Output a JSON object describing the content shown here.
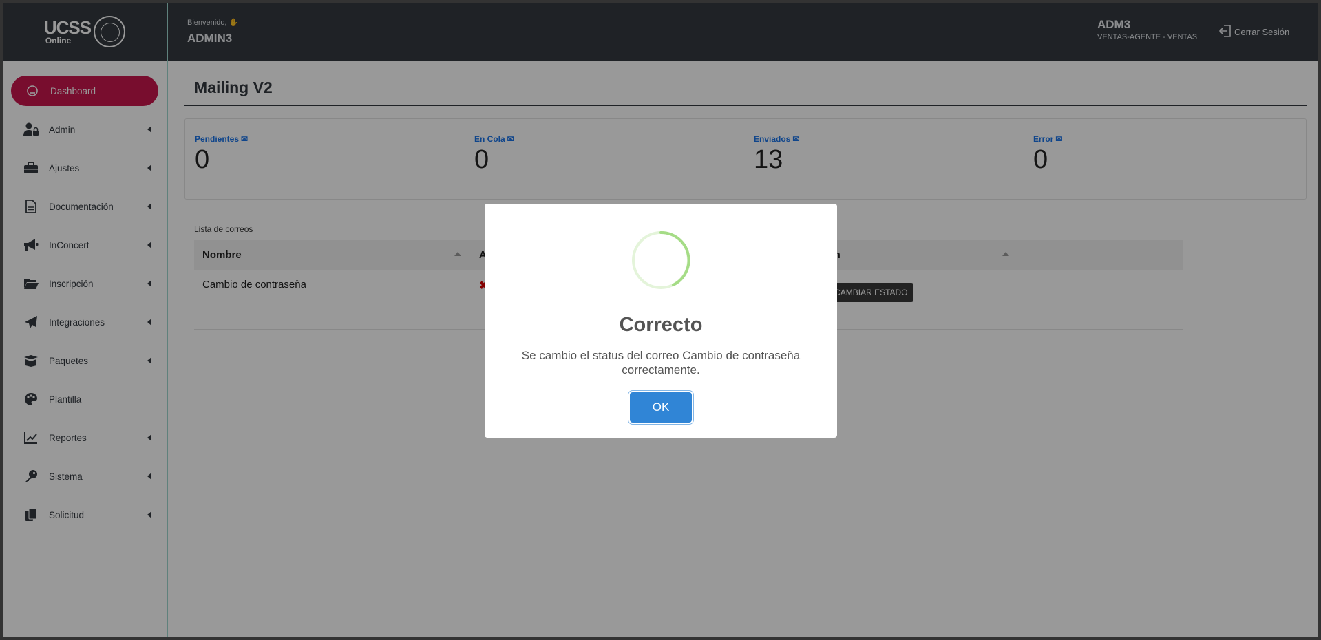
{
  "brand": {
    "name": "UCSS",
    "sub": "Online"
  },
  "header": {
    "welcome": "Bienvenido,",
    "user_name": "ADMIN3",
    "user_code": "ADM3",
    "user_role": "VENTAS-AGENTE - VENTAS",
    "logout_label": "Cerrar Sesión"
  },
  "sidebar": {
    "items": [
      {
        "label": "Dashboard",
        "icon": "dashboard-icon",
        "active": true
      },
      {
        "label": "Admin",
        "icon": "user-lock-icon"
      },
      {
        "label": "Ajustes",
        "icon": "toolbox-icon"
      },
      {
        "label": "Documentación",
        "icon": "file-icon"
      },
      {
        "label": "InConcert",
        "icon": "megaphone-icon"
      },
      {
        "label": "Inscripción",
        "icon": "folder-open-icon"
      },
      {
        "label": "Integraciones",
        "icon": "paper-plane-icon"
      },
      {
        "label": "Paquetes",
        "icon": "box-open-icon"
      },
      {
        "label": "Plantilla",
        "icon": "palette-icon"
      },
      {
        "label": "Reportes",
        "icon": "chart-line-icon"
      },
      {
        "label": "Sistema",
        "icon": "key-icon"
      },
      {
        "label": "Solicitud",
        "icon": "clipboard-icon"
      }
    ]
  },
  "main": {
    "title": "Mailing V2",
    "stats": [
      {
        "label": "Pendientes",
        "value": "0"
      },
      {
        "label": "En Cola",
        "value": "0"
      },
      {
        "label": "Enviados",
        "value": "13"
      },
      {
        "label": "Error",
        "value": "0"
      }
    ],
    "list_label": "Lista de correos",
    "table": {
      "col_name": "Nombre",
      "col_a": "A",
      "col_action": "cion",
      "row_name": "Cambio de contraseña",
      "row_action": "CAMBIAR ESTADO"
    }
  },
  "modal": {
    "title": "Correcto",
    "text": "Se cambio el status del correo Cambio de contraseña correctamente.",
    "ok_label": "OK"
  },
  "colors": {
    "accent": "#c8174e",
    "dark": "#343a40",
    "link": "#1a73e8",
    "ok": "#3085d6",
    "spinner": "#a5dc86"
  }
}
